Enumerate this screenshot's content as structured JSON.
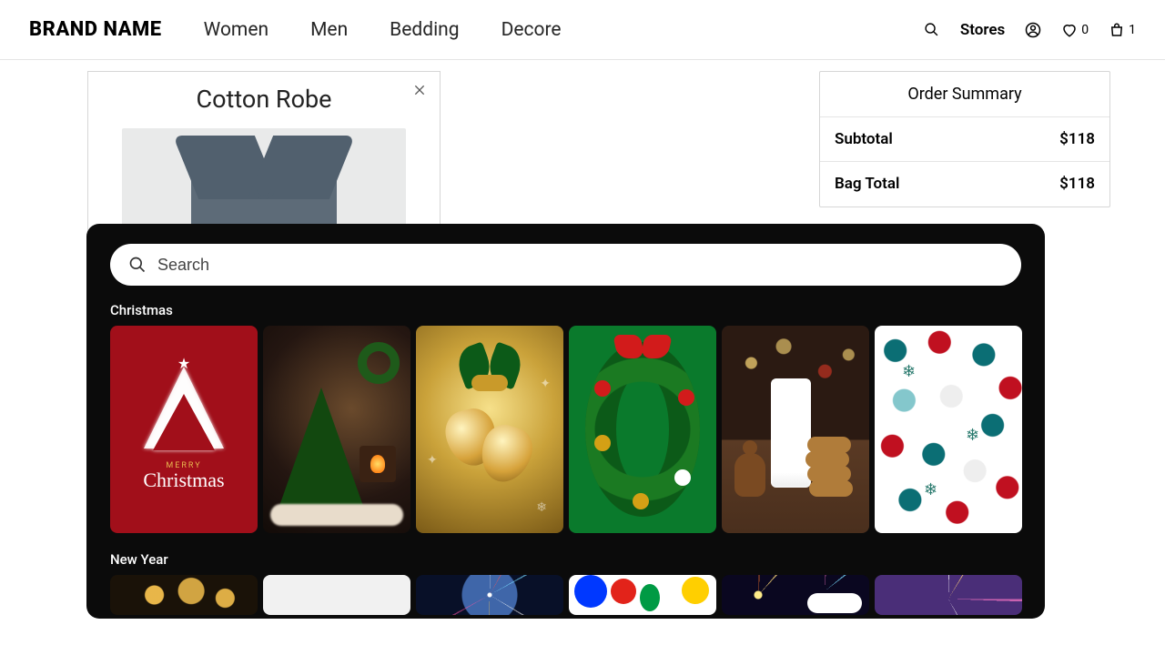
{
  "header": {
    "brand": "BRAND NAME",
    "nav": [
      "Women",
      "Men",
      "Bedding",
      "Decore"
    ],
    "stores": "Stores",
    "wishlist_count": "0",
    "bag_count": "1"
  },
  "cart_item": {
    "title": "Cotton Robe"
  },
  "order_summary": {
    "title": "Order Summary",
    "rows": [
      {
        "label": "Subtotal",
        "value": "$118"
      },
      {
        "label": "Bag Total",
        "value": "$118"
      }
    ]
  },
  "picker": {
    "search_placeholder": "Search",
    "sections": [
      {
        "title": "Christmas",
        "card_text": {
          "small": "MERRY",
          "script": "Christmas"
        }
      },
      {
        "title": "New Year"
      }
    ]
  }
}
